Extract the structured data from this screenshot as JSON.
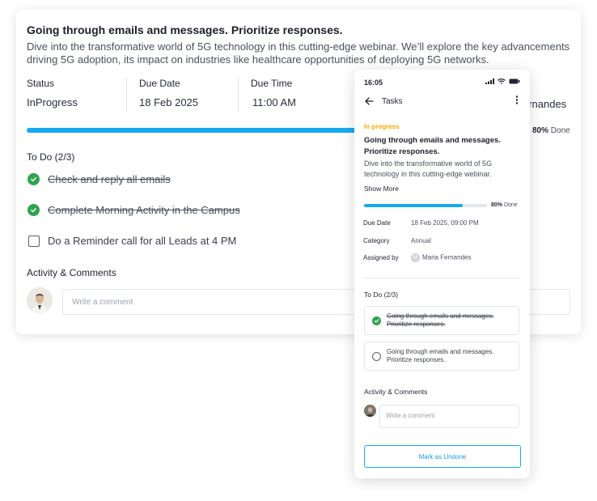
{
  "desktop": {
    "title": "Going through emails and messages. Prioritize responses.",
    "description": "Dive into the transformative world of 5G technology in this cutting-edge webinar. We’ll explore the key advancements driving 5G adoption, its impact on industries like healthcare opportunities of deploying 5G networks.",
    "meta": {
      "status_label": "Status",
      "status_value": "InProgress",
      "due_date_label": "Due Date",
      "due_date_value": "18 Feb 2025",
      "due_time_label": "Due Time",
      "due_time_value": "11:00 AM",
      "assignee_partial": "ernandes"
    },
    "progress": {
      "percent": 80,
      "percent_text": "80%",
      "done_label": "Done"
    },
    "todo_heading": "To Do (2/3)",
    "todos": [
      {
        "label": "Check and reply all emails",
        "done": true
      },
      {
        "label": "Complete Morning Activity in the Campus",
        "done": true
      },
      {
        "label": "Do a Reminder call for all Leads at 4 PM",
        "done": false
      }
    ],
    "activity_heading": "Activity & Comments",
    "comment_placeholder": "Write a comment"
  },
  "mobile": {
    "time": "16:05",
    "header_title": "Tasks",
    "status": "In progress",
    "title": "Going through emails and messages. Prioritize responses.",
    "description": "Dive into the transformative world of 5G technology in this cutting-edge webinar.",
    "show_more": "Show More",
    "progress": {
      "percent": 80,
      "percent_text": "80%",
      "done_label": "Done"
    },
    "details": {
      "due_date_label": "Due Date",
      "due_date_value": "18 Feb 2025, 09:00 PM",
      "category_label": "Category",
      "category_value": "Annual",
      "assigned_label": "Assigned by",
      "assigned_initial": "M",
      "assigned_value": "Maria Fernandes"
    },
    "todo_heading": "To Do (2/3)",
    "todos": [
      {
        "label": "Going through emails and messages. Prioritize responses.",
        "done": true
      },
      {
        "label": "Going through emails and messages. Prioritize responses.",
        "done": false
      }
    ],
    "activity_heading": "Activity & Comments",
    "comment_placeholder": "Write a comment",
    "button_label": "Mark as Undone"
  },
  "colors": {
    "accent": "#16a9f2",
    "status": "#f5b400",
    "check": "#2ea44f"
  },
  "icons": {
    "back": "arrow-left-icon",
    "more": "more-vertical-icon",
    "check": "check-circle-icon",
    "signal": "signal-icon",
    "wifi": "wifi-icon",
    "battery": "battery-icon"
  }
}
